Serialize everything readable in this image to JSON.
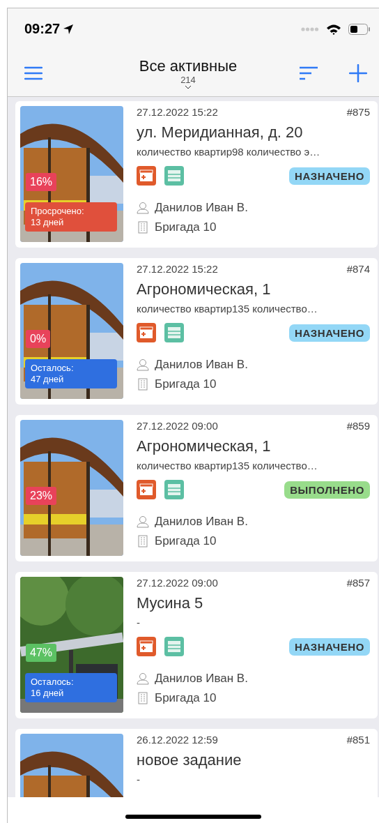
{
  "status_bar": {
    "time": "09:27"
  },
  "nav": {
    "title": "Все активные",
    "count": "214"
  },
  "cards": [
    {
      "date": "27.12.2022 15:22",
      "number": "#875",
      "title": "ул. Меридианная, д. 20",
      "subtitle": "количество квартир98 количество э…",
      "percent": {
        "text": "16%",
        "color": "#e8425a"
      },
      "deadline": {
        "kind": "overdue",
        "label": "Просрочено:",
        "days": "13 дней"
      },
      "status": {
        "kind": "assigned",
        "text": "НАЗНАЧЕНО"
      },
      "person": "Данилов Иван В.",
      "team": "Бригада 10"
    },
    {
      "date": "27.12.2022 15:22",
      "number": "#874",
      "title": "Агрономическая, 1",
      "subtitle": "количество квартир135 количество…",
      "percent": {
        "text": "0%",
        "color": "#e8425a"
      },
      "deadline": {
        "kind": "remaining",
        "label": "Осталось:",
        "days": "47 дней"
      },
      "status": {
        "kind": "assigned",
        "text": "НАЗНАЧЕНО"
      },
      "person": "Данилов Иван В.",
      "team": "Бригада 10"
    },
    {
      "date": "27.12.2022 09:00",
      "number": "#859",
      "title": "Агрономическая, 1",
      "subtitle": "количество квартир135 количество…",
      "percent": {
        "text": "23%",
        "color": "#e8425a"
      },
      "status": {
        "kind": "done",
        "text": "ВЫПОЛНЕНО"
      },
      "person": "Данилов Иван В.",
      "team": "Бригада 10"
    },
    {
      "date": "27.12.2022 09:00",
      "number": "#857",
      "title": "Мусина 5",
      "subtitle": "-",
      "percent": {
        "text": "47%",
        "color": "#5cc163"
      },
      "deadline": {
        "kind": "remaining",
        "label": "Осталось:",
        "days": "16 дней"
      },
      "status": {
        "kind": "assigned",
        "text": "НАЗНАЧЕНО"
      },
      "person": "Данилов Иван В.",
      "team": "Бригада 10"
    },
    {
      "date": "26.12.2022 12:59",
      "number": "#851",
      "title": "новое задание",
      "subtitle": "-"
    }
  ]
}
